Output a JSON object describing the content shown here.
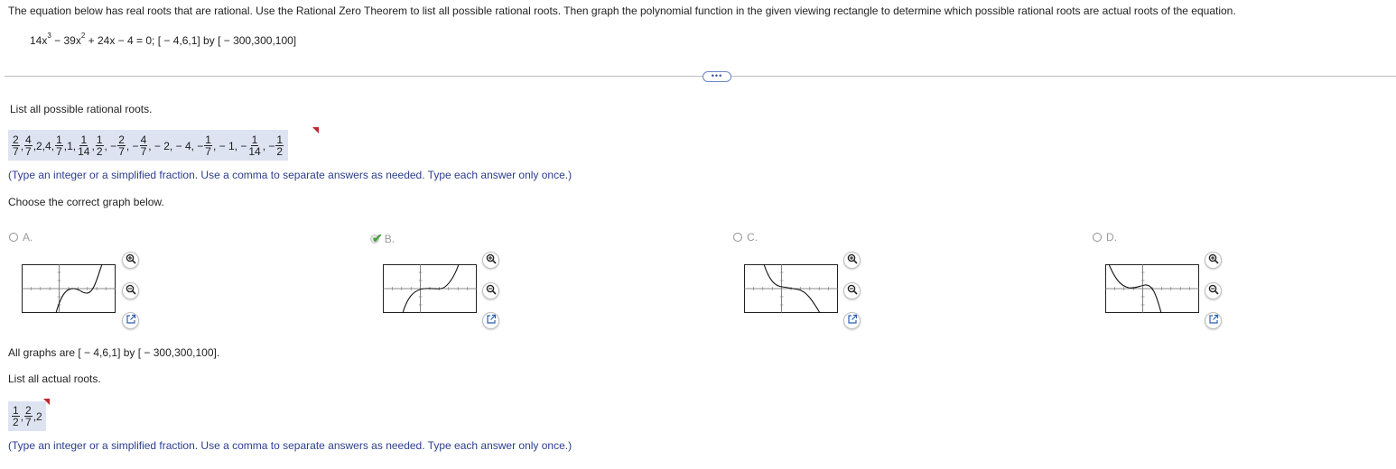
{
  "instructions": "The equation below has real roots that are rational. Use the Rational Zero Theorem to list all possible rational roots. Then graph the polynomial function in the given viewing rectangle to determine which possible rational roots are actual roots of the equation.",
  "equation": {
    "t1": "14x",
    "e1": "3",
    "t2": " − 39x",
    "e2": "2",
    "t3": " + 24x − 4 = 0; [ − 4,6,1] by [ − 300,300,100]"
  },
  "more_button": "•••",
  "possible_roots": {
    "label": "List all possible rational roots.",
    "hint": "(Type an integer or a simplified fraction. Use a comma to separate answers as needed. Type each answer only once.)",
    "answer": [
      {
        "n": "2",
        "d": "7"
      },
      ",",
      {
        "n": "4",
        "d": "7"
      },
      ",2,4,",
      {
        "n": "1",
        "d": "7"
      },
      ",1,",
      {
        "n": "1",
        "d": "14"
      },
      ",",
      {
        "n": "1",
        "d": "2"
      },
      ", − ",
      {
        "n": "2",
        "d": "7"
      },
      ", − ",
      {
        "n": "4",
        "d": "7"
      },
      ", − 2, − 4, − ",
      {
        "n": "1",
        "d": "7"
      },
      ", − 1, − ",
      {
        "n": "1",
        "d": "14"
      },
      ", − ",
      {
        "n": "1",
        "d": "2"
      }
    ]
  },
  "choose_label": "Choose the correct graph below.",
  "options": [
    {
      "letter": "A.",
      "selected": false
    },
    {
      "letter": "B.",
      "selected": true
    },
    {
      "letter": "C.",
      "selected": false
    },
    {
      "letter": "D.",
      "selected": false
    }
  ],
  "all_graphs_note": "All graphs are [ − 4,6,1] by [ − 300,300,100].",
  "actual_roots": {
    "label": "List all actual roots.",
    "answer": [
      {
        "n": "1",
        "d": "2"
      },
      ",",
      {
        "n": "2",
        "d": "7"
      },
      ",2"
    ],
    "hint": "(Type an integer or a simplified fraction. Use a comma to separate answers as needed. Type each answer only once.)"
  },
  "colors": {
    "answer_bg": "#dde3f1",
    "hint_text": "#2c3e8f",
    "flag": "#c0262d",
    "check": "#48a23f"
  },
  "icons": [
    "zoom-in-icon",
    "zoom-out-icon",
    "open-new-window-icon",
    "check-mark-icon"
  ]
}
